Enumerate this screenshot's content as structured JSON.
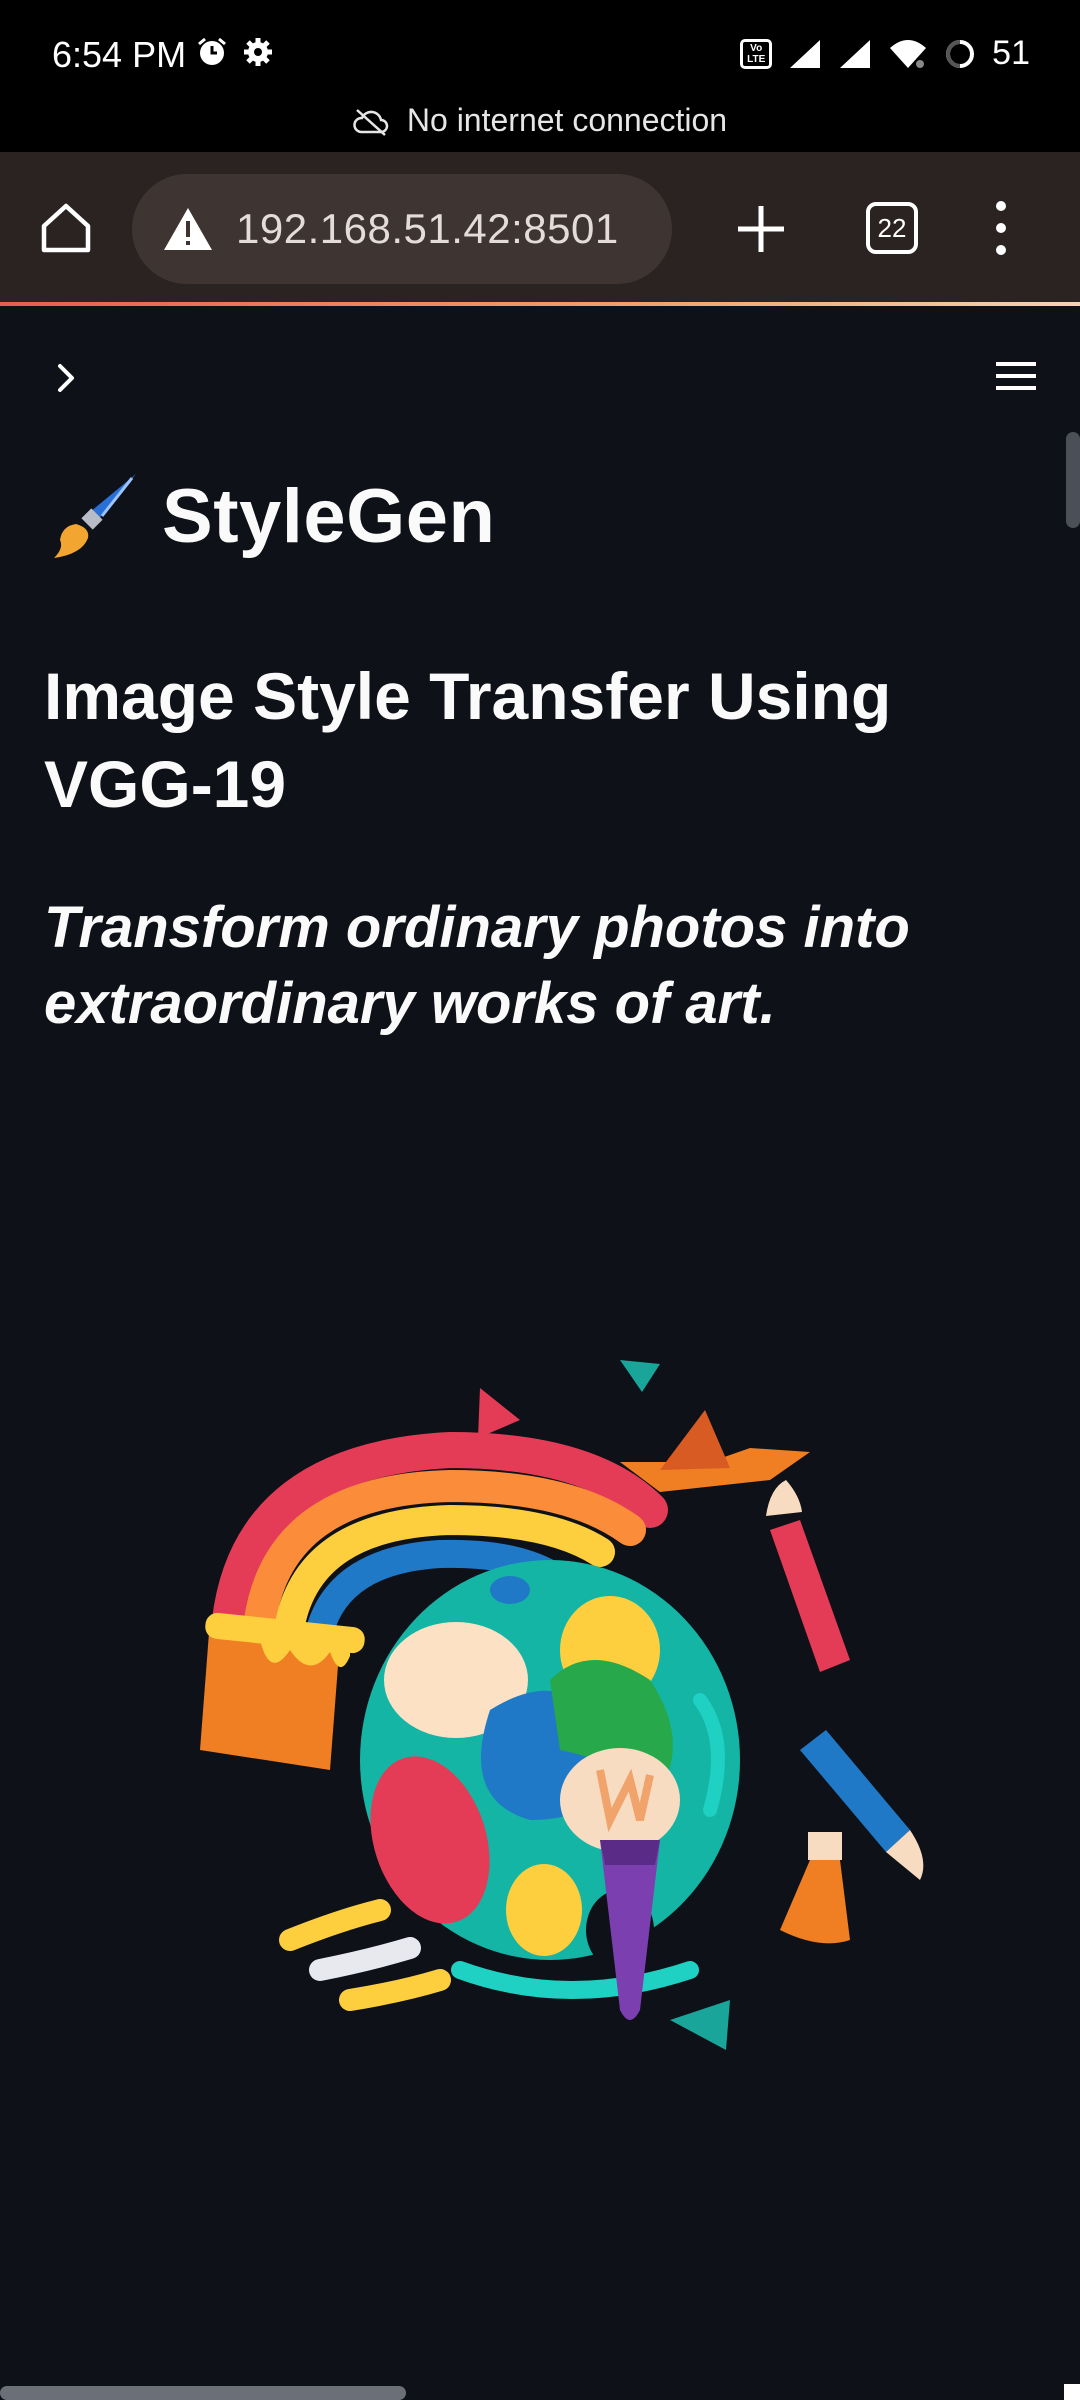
{
  "status_bar": {
    "time": "6:54 PM",
    "battery_level": "51",
    "icons": [
      "alarm-icon",
      "settings-icon",
      "volte-icon",
      "signal-icon",
      "signal-icon",
      "wifi-icon",
      "battery-icon"
    ],
    "volte_label_top": "Vo",
    "volte_label_bottom": "LTE"
  },
  "network_banner": {
    "text": "No internet connection",
    "icon": "cloud-off-icon"
  },
  "browser": {
    "url": "192.168.51.42:8501",
    "tab_count": "22",
    "icons": [
      "home-icon",
      "warning-icon",
      "plus-icon",
      "tabs-icon",
      "more-icon"
    ]
  },
  "app": {
    "title": "StyleGen",
    "subtitle": "Image Style Transfer Using VGG-19",
    "tagline": "Transform ordinary photos into extraordinary works of art.",
    "icons": [
      "chevron-right-icon",
      "hamburger-menu-icon",
      "paintbrush-icon"
    ]
  },
  "colors": {
    "page_background": "#0e1117",
    "toolbar_background": "#2a2322",
    "urlbar_background": "#3e3533",
    "accent_line": "#e85d4e"
  }
}
